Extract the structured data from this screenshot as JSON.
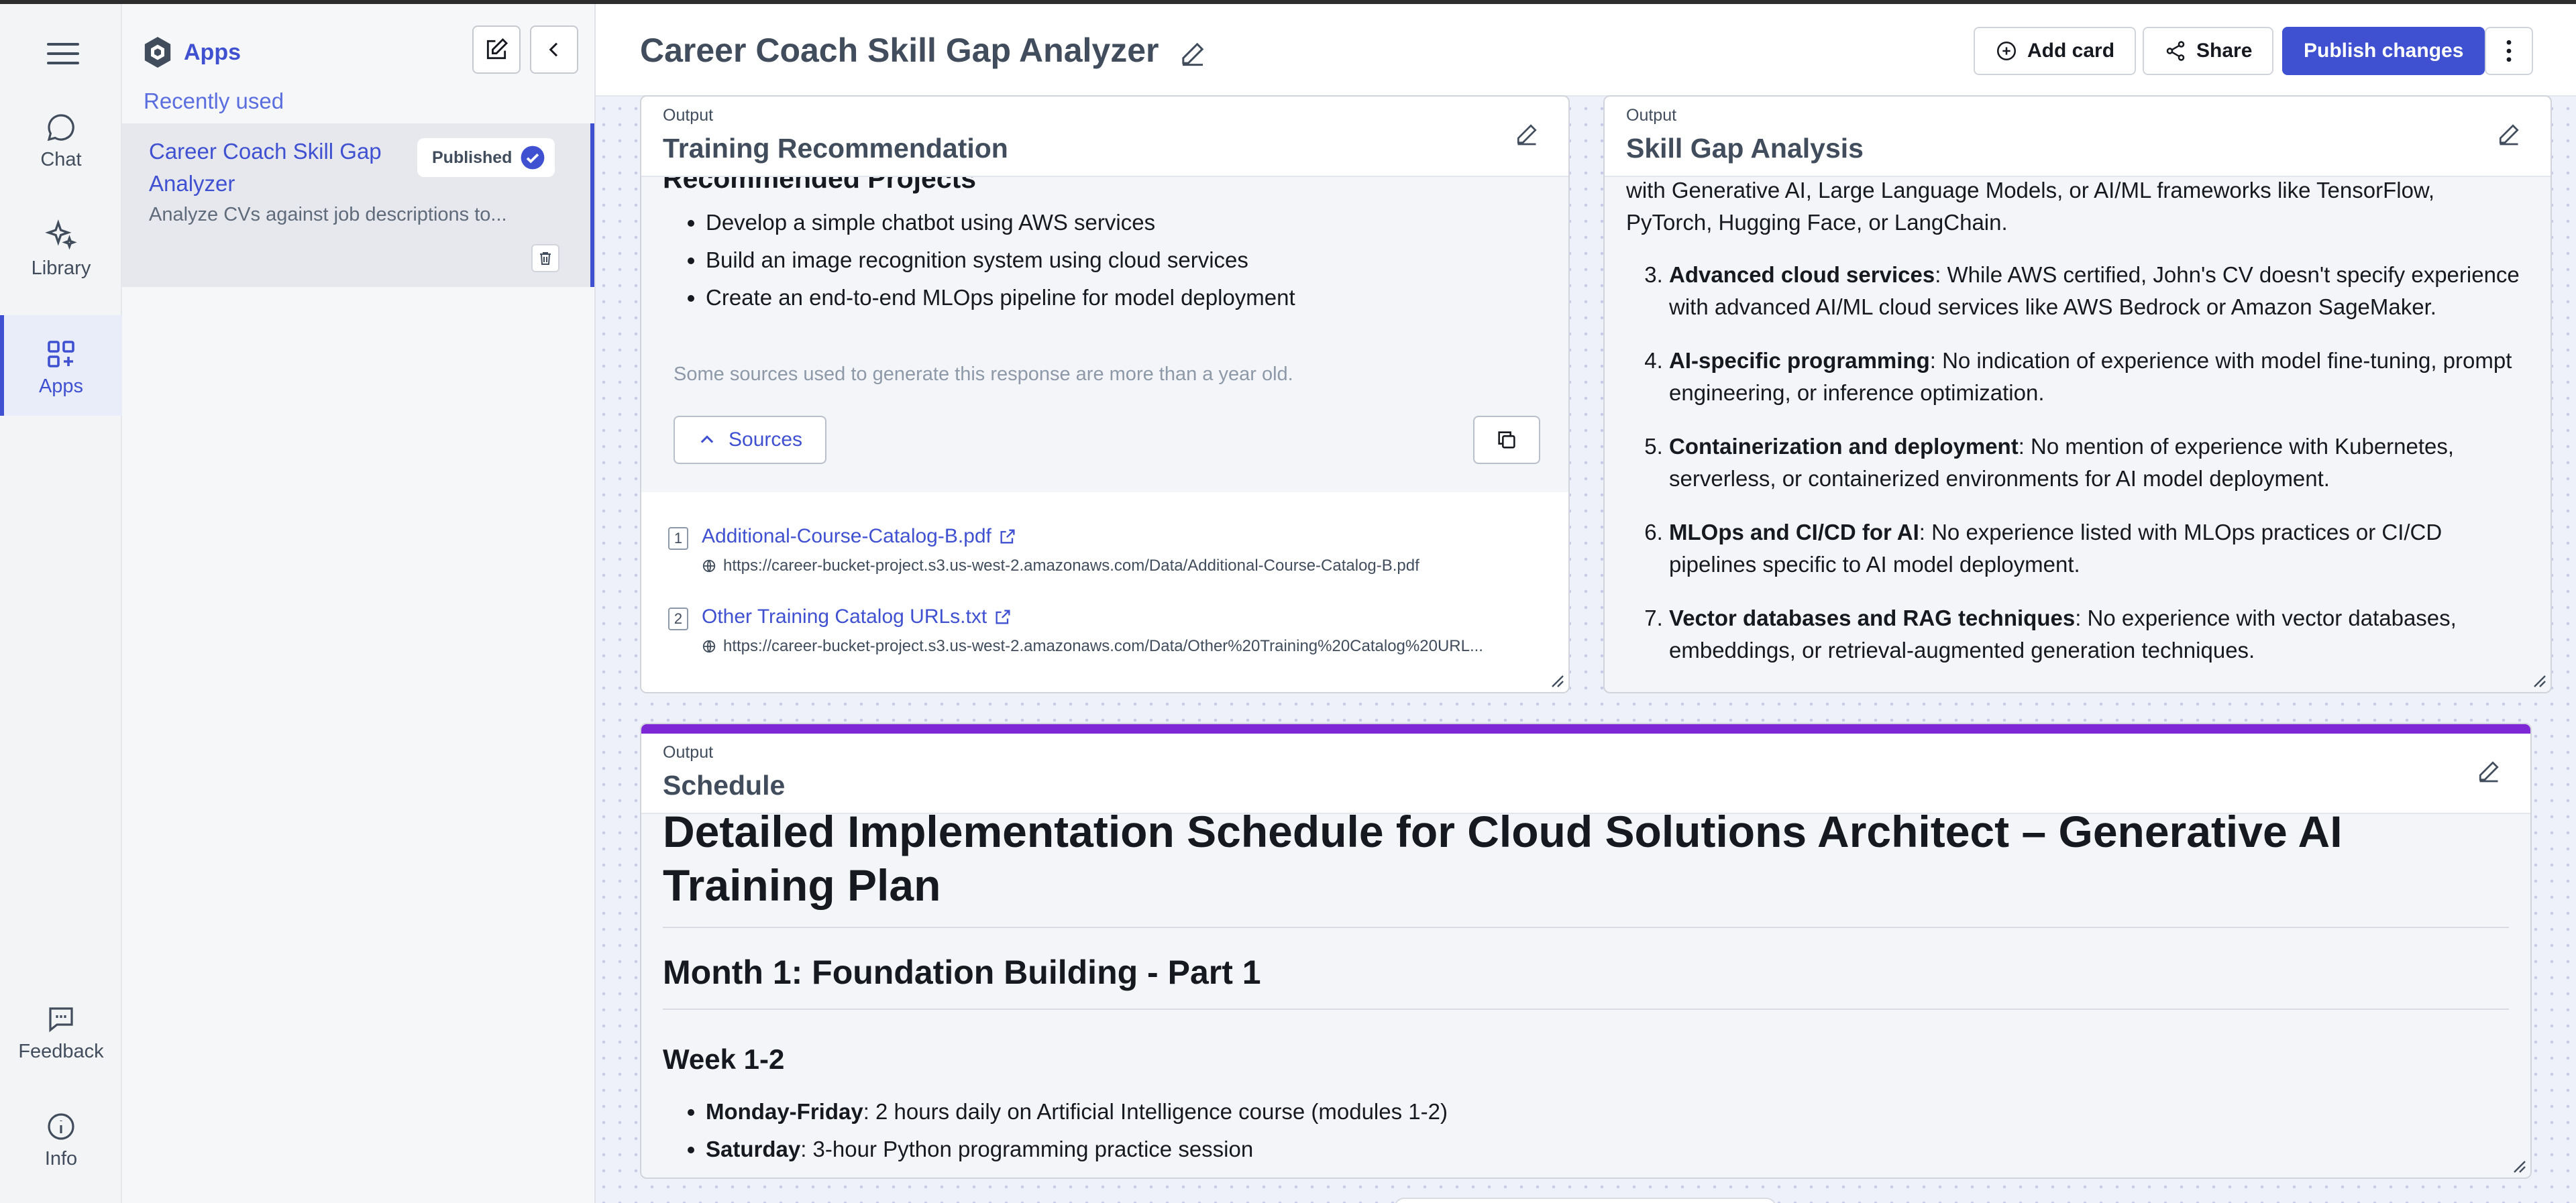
{
  "rail": {
    "items": [
      {
        "label": "Chat",
        "icon": "chat-bubble-icon"
      },
      {
        "label": "Library",
        "icon": "sparkle-icon"
      },
      {
        "label": "Apps",
        "icon": "apps-grid-icon"
      },
      {
        "label": "Feedback",
        "icon": "feedback-icon"
      },
      {
        "label": "Info",
        "icon": "info-icon"
      }
    ]
  },
  "panel": {
    "title": "Apps",
    "recent_label": "Recently used",
    "app": {
      "name": "Career Coach Skill Gap Analyzer",
      "description": "Analyze CVs against job descriptions to...",
      "badge": "Published"
    }
  },
  "header": {
    "title": "Career Coach Skill Gap Analyzer",
    "add_card": "Add card",
    "share": "Share",
    "publish": "Publish changes"
  },
  "training": {
    "kind": "Output",
    "title": "Training Recommendation",
    "cut_heading": "Recommended Projects",
    "projects": [
      "Develop a simple chatbot using AWS services",
      "Build an image recognition system using cloud services",
      "Create an end-to-end MLOps pipeline for model deployment"
    ],
    "note": "Some sources used to generate this response are more than a year old.",
    "sources_label": "Sources",
    "sources": [
      {
        "index": "1",
        "name": "Additional-Course-Catalog-B.pdf",
        "url": "https://career-bucket-project.s3.us-west-2.amazonaws.com/Data/Additional-Course-Catalog-B.pdf"
      },
      {
        "index": "2",
        "name": "Other Training Catalog URLs.txt",
        "url": "https://career-bucket-project.s3.us-west-2.amazonaws.com/Data/Other%20Training%20Catalog%20URL..."
      }
    ]
  },
  "skillgap": {
    "kind": "Output",
    "title": "Skill Gap Analysis",
    "intro_lines": [
      "with Generative AI, Large Language Models, or AI/ML frameworks like TensorFlow,",
      "PyTorch, Hugging Face, or LangChain."
    ],
    "items": [
      {
        "n": "3",
        "term": "Advanced cloud services",
        "text": ": While AWS certified, John's CV doesn't specify experience with advanced AI/ML cloud services like AWS Bedrock or Amazon SageMaker."
      },
      {
        "n": "4",
        "term": "AI-specific programming",
        "text": ": No indication of experience with model fine-tuning, prompt engineering, or inference optimization."
      },
      {
        "n": "5",
        "term": "Containerization and deployment",
        "text": ": No mention of experience with Kubernetes, serverless, or containerized environments for AI model deployment."
      },
      {
        "n": "6",
        "term": "MLOps and CI/CD for AI",
        "text": ": No experience listed with MLOps practices or CI/CD pipelines specific to AI model deployment."
      },
      {
        "n": "7",
        "term": "Vector databases and RAG techniques",
        "text": ": No experience with vector databases, embeddings, or retrieval-augmented generation techniques."
      }
    ]
  },
  "schedule": {
    "kind": "Output",
    "title": "Schedule",
    "h1": "Detailed Implementation Schedule for Cloud Solutions Architect – Generative AI Training Plan",
    "h2": "Month 1: Foundation Building - Part 1",
    "h3": "Week 1-2",
    "items": [
      {
        "term": "Monday-Friday",
        "text": ": 2 hours daily on Artificial Intelligence course (modules 1-2)"
      },
      {
        "term": "Saturday",
        "text": ": 3-hour Python programming practice session"
      }
    ]
  },
  "colors": {
    "accent": "#3f51d1",
    "schedule_bar": "#7d27d6"
  }
}
